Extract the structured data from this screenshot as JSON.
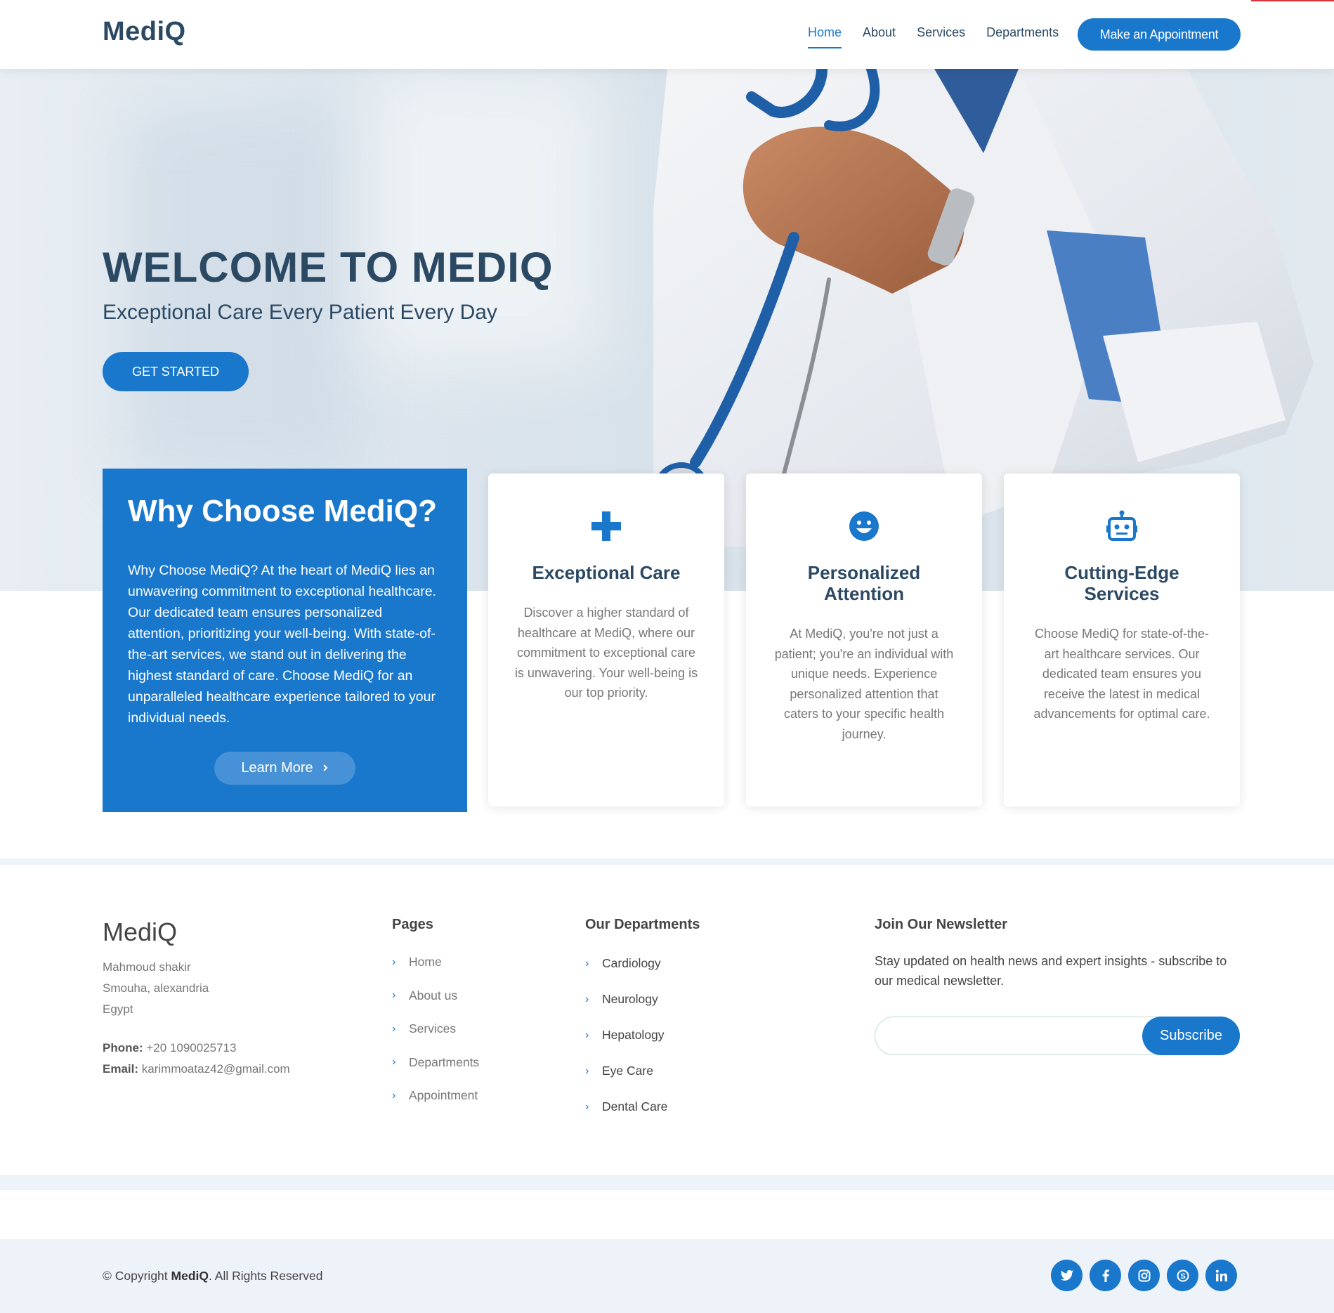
{
  "header": {
    "logo": "MediQ",
    "nav": [
      "Home",
      "About",
      "Services",
      "Departments"
    ],
    "active_nav": "Home",
    "appointment_button": "Make an Appointment"
  },
  "hero": {
    "title": "WELCOME TO MEDIQ",
    "subtitle": "Exceptional Care Every Patient Every Day",
    "cta": "GET STARTED"
  },
  "why": {
    "title": "Why Choose MediQ?",
    "text": "Why Choose MediQ? At the heart of MediQ lies an unwavering commitment to exceptional healthcare. Our dedicated team ensures personalized attention, prioritizing your well-being. With state-of-the-art services, we stand out in delivering the highest standard of care. Choose MediQ for an unparalleled healthcare experience tailored to your individual needs.",
    "button": "Learn More"
  },
  "cards": [
    {
      "icon": "plus-icon",
      "title": "Exceptional Care",
      "text": "Discover a higher standard of healthcare at MediQ, where our commitment to exceptional care is unwavering. Your well-being is our top priority."
    },
    {
      "icon": "smile-icon",
      "title": "Personalized Attention",
      "text": "At MediQ, you're not just a patient; you're an individual with unique needs. Experience personalized attention that caters to your specific health journey."
    },
    {
      "icon": "robot-icon",
      "title": "Cutting-Edge Services",
      "text": "Choose MediQ for state-of-the-art healthcare services. Our dedicated team ensures you receive the latest in medical advancements for optimal care."
    }
  ],
  "footer": {
    "logo": "MediQ",
    "address": [
      "Mahmoud shakir",
      "Smouha, alexandria",
      "Egypt"
    ],
    "phone_label": "Phone:",
    "phone": "+20 1090025713",
    "email_label": "Email:",
    "email": "karimmoataz42@gmail.com",
    "pages_title": "Pages",
    "pages": [
      "Home",
      "About us",
      "Services",
      "Departments",
      "Appointment"
    ],
    "departments_title": "Our Departments",
    "departments": [
      "Cardiology",
      "Neurology",
      "Hepatology",
      "Eye Care",
      "Dental Care"
    ],
    "newsletter_title": "Join Our Newsletter",
    "newsletter_text": "Stay updated on health news and expert insights - subscribe to our medical newsletter.",
    "newsletter_placeholder": "",
    "subscribe_button": "Subscribe",
    "copyright_prefix": "© Copyright",
    "copyright_brand": "MediQ",
    "copyright_suffix": ". All Rights Reserved",
    "socials": [
      "twitter-icon",
      "facebook-icon",
      "instagram-icon",
      "skype-icon",
      "linkedin-icon"
    ]
  },
  "colors": {
    "accent": "#1977cc",
    "heading": "#2c4964",
    "text_muted": "#777777",
    "footer_bg": "#eef3fa"
  }
}
